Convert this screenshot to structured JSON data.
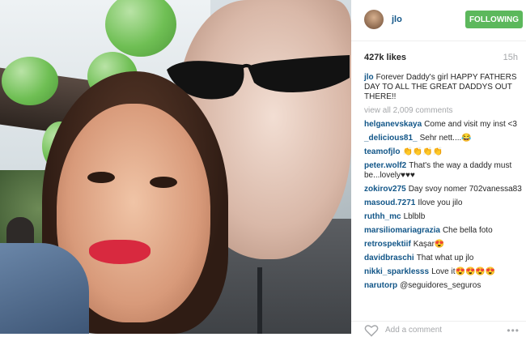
{
  "post": {
    "username": "jlo",
    "follow_label": "FOLLOWING",
    "likes": "427k likes",
    "time": "15h",
    "caption_user": "jlo",
    "caption_text": "Forever Daddy's girl HAPPY FATHERS DAY TO ALL THE GREAT DADDYS OUT THERE!!",
    "view_all": "view all 2,009 comments",
    "add_comment_placeholder": "Add a comment",
    "more_label": "•••"
  },
  "comments": [
    {
      "user": "helganevskaya",
      "text": "Come and visit my inst <3"
    },
    {
      "user": "_delicious81_",
      "text": "Sehr nett....😂"
    },
    {
      "user": "teamofjlo",
      "text": "👏👏👏👏"
    },
    {
      "user": "peter.wolf2",
      "text": "That's the way a daddy must be...lovely♥♥♥"
    },
    {
      "user": "zokirov275",
      "text": "Day svoy nomer 702vanessa83"
    },
    {
      "user": "masoud.7271",
      "text": "Ilove you jilo"
    },
    {
      "user": "ruthh_mc",
      "text": "Lblblb"
    },
    {
      "user": "marsiliomariagrazia",
      "text": "Che bella foto"
    },
    {
      "user": "retrospektiif",
      "text": "Kaşar😍"
    },
    {
      "user": "davidbraschi",
      "text": "That what up jlo"
    },
    {
      "user": "nikki_sparklesss",
      "text": "Love it😍😍😍😍"
    },
    {
      "user": "narutorp",
      "text": "@seguidores_seguros"
    }
  ],
  "colors": {
    "link_blue": "#125688",
    "follow_green": "#5cb85c",
    "muted_gray": "#a5a7aa"
  },
  "icons": {
    "heart": "heart-icon",
    "avatar": "avatar"
  }
}
